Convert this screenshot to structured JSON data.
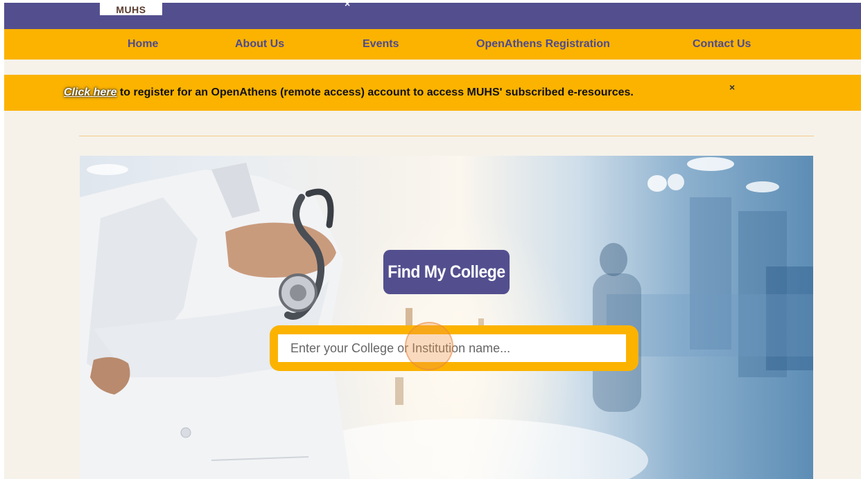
{
  "header": {
    "logo_text": "MUHS",
    "close_glyph": "×"
  },
  "nav": {
    "items": [
      {
        "label": "Home"
      },
      {
        "label": "About Us"
      },
      {
        "label": "Events"
      },
      {
        "label": "OpenAthens Registration"
      },
      {
        "label": "Contact Us"
      }
    ]
  },
  "banner": {
    "link_text": "Click here",
    "message": " to register for an OpenAthens (remote access) account to access MUHS' subscribed e-resources.",
    "close_glyph": "×"
  },
  "hero": {
    "button_label": "Find My College",
    "search_placeholder": "Enter your College or Institution name..."
  },
  "colors": {
    "brand_purple": "#534f8f",
    "brand_yellow": "#fbb300",
    "page_bg": "#f6f2ea"
  }
}
